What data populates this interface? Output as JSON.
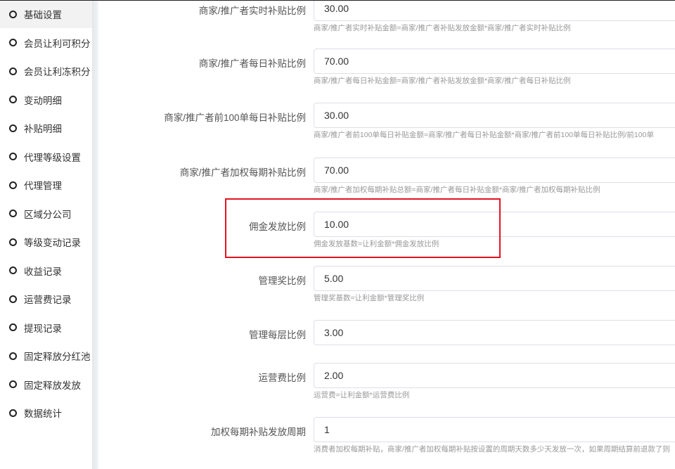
{
  "sidebar": {
    "items": [
      {
        "label": "基础设置",
        "active": true
      },
      {
        "label": "会员让利可积分"
      },
      {
        "label": "会员让利冻积分"
      },
      {
        "label": "变动明细"
      },
      {
        "label": "补贴明细"
      },
      {
        "label": "代理等级设置"
      },
      {
        "label": "代理管理"
      },
      {
        "label": "区域分公司"
      },
      {
        "label": "等级变动记录"
      },
      {
        "label": "收益记录"
      },
      {
        "label": "运营费记录"
      },
      {
        "label": "提现记录"
      },
      {
        "label": "固定释放分红池"
      },
      {
        "label": "固定释放发放"
      },
      {
        "label": "数据统计"
      }
    ]
  },
  "form": {
    "fields": [
      {
        "label": "商家/推广者实时补贴比例",
        "value": "30.00",
        "hint": "商家/推广者实时补贴金额=商家/推广者补贴发放金额*商家/推广者实时补贴比例"
      },
      {
        "label": "商家/推广者每日补贴比例",
        "value": "70.00",
        "hint": "商家/推广者每日补贴金额=商家/推广者补贴发放金额*商家/推广者每日补贴比例"
      },
      {
        "label": "商家/推广者前100单每日补贴比例",
        "value": "30.00",
        "hint": "商家/推广者前100单每日补贴金额=商家/推广者每日补贴金额*商家/推广者前100单每日补贴比例/前100单"
      },
      {
        "label": "商家/推广者加权每期补贴比例",
        "value": "70.00",
        "hint": "商家/推广者加权每期补贴总额=商家/推广者每日补贴金额*商家/推广者加权每期补贴比例"
      },
      {
        "label": "佣金发放比例",
        "value": "10.00",
        "hint": "佣金发放基数=让利金额*佣金发放比例"
      },
      {
        "label": "管理奖比例",
        "value": "5.00",
        "hint": "管理奖基数=让利金额*管理奖比例"
      },
      {
        "label": "管理每层比例",
        "value": "3.00",
        "hint": ""
      },
      {
        "label": "运营费比例",
        "value": "2.00",
        "hint": "运营费=让利金额*运营费比例"
      },
      {
        "label": "加权每期补贴发放周期",
        "value": "1",
        "hint": "消费者加权每期补贴，商家/推广者加权每期补贴按设置的周期天数多少天发放一次，如果周期结算前退款了则"
      }
    ]
  },
  "colors": {
    "highlight": "#e3141f"
  }
}
